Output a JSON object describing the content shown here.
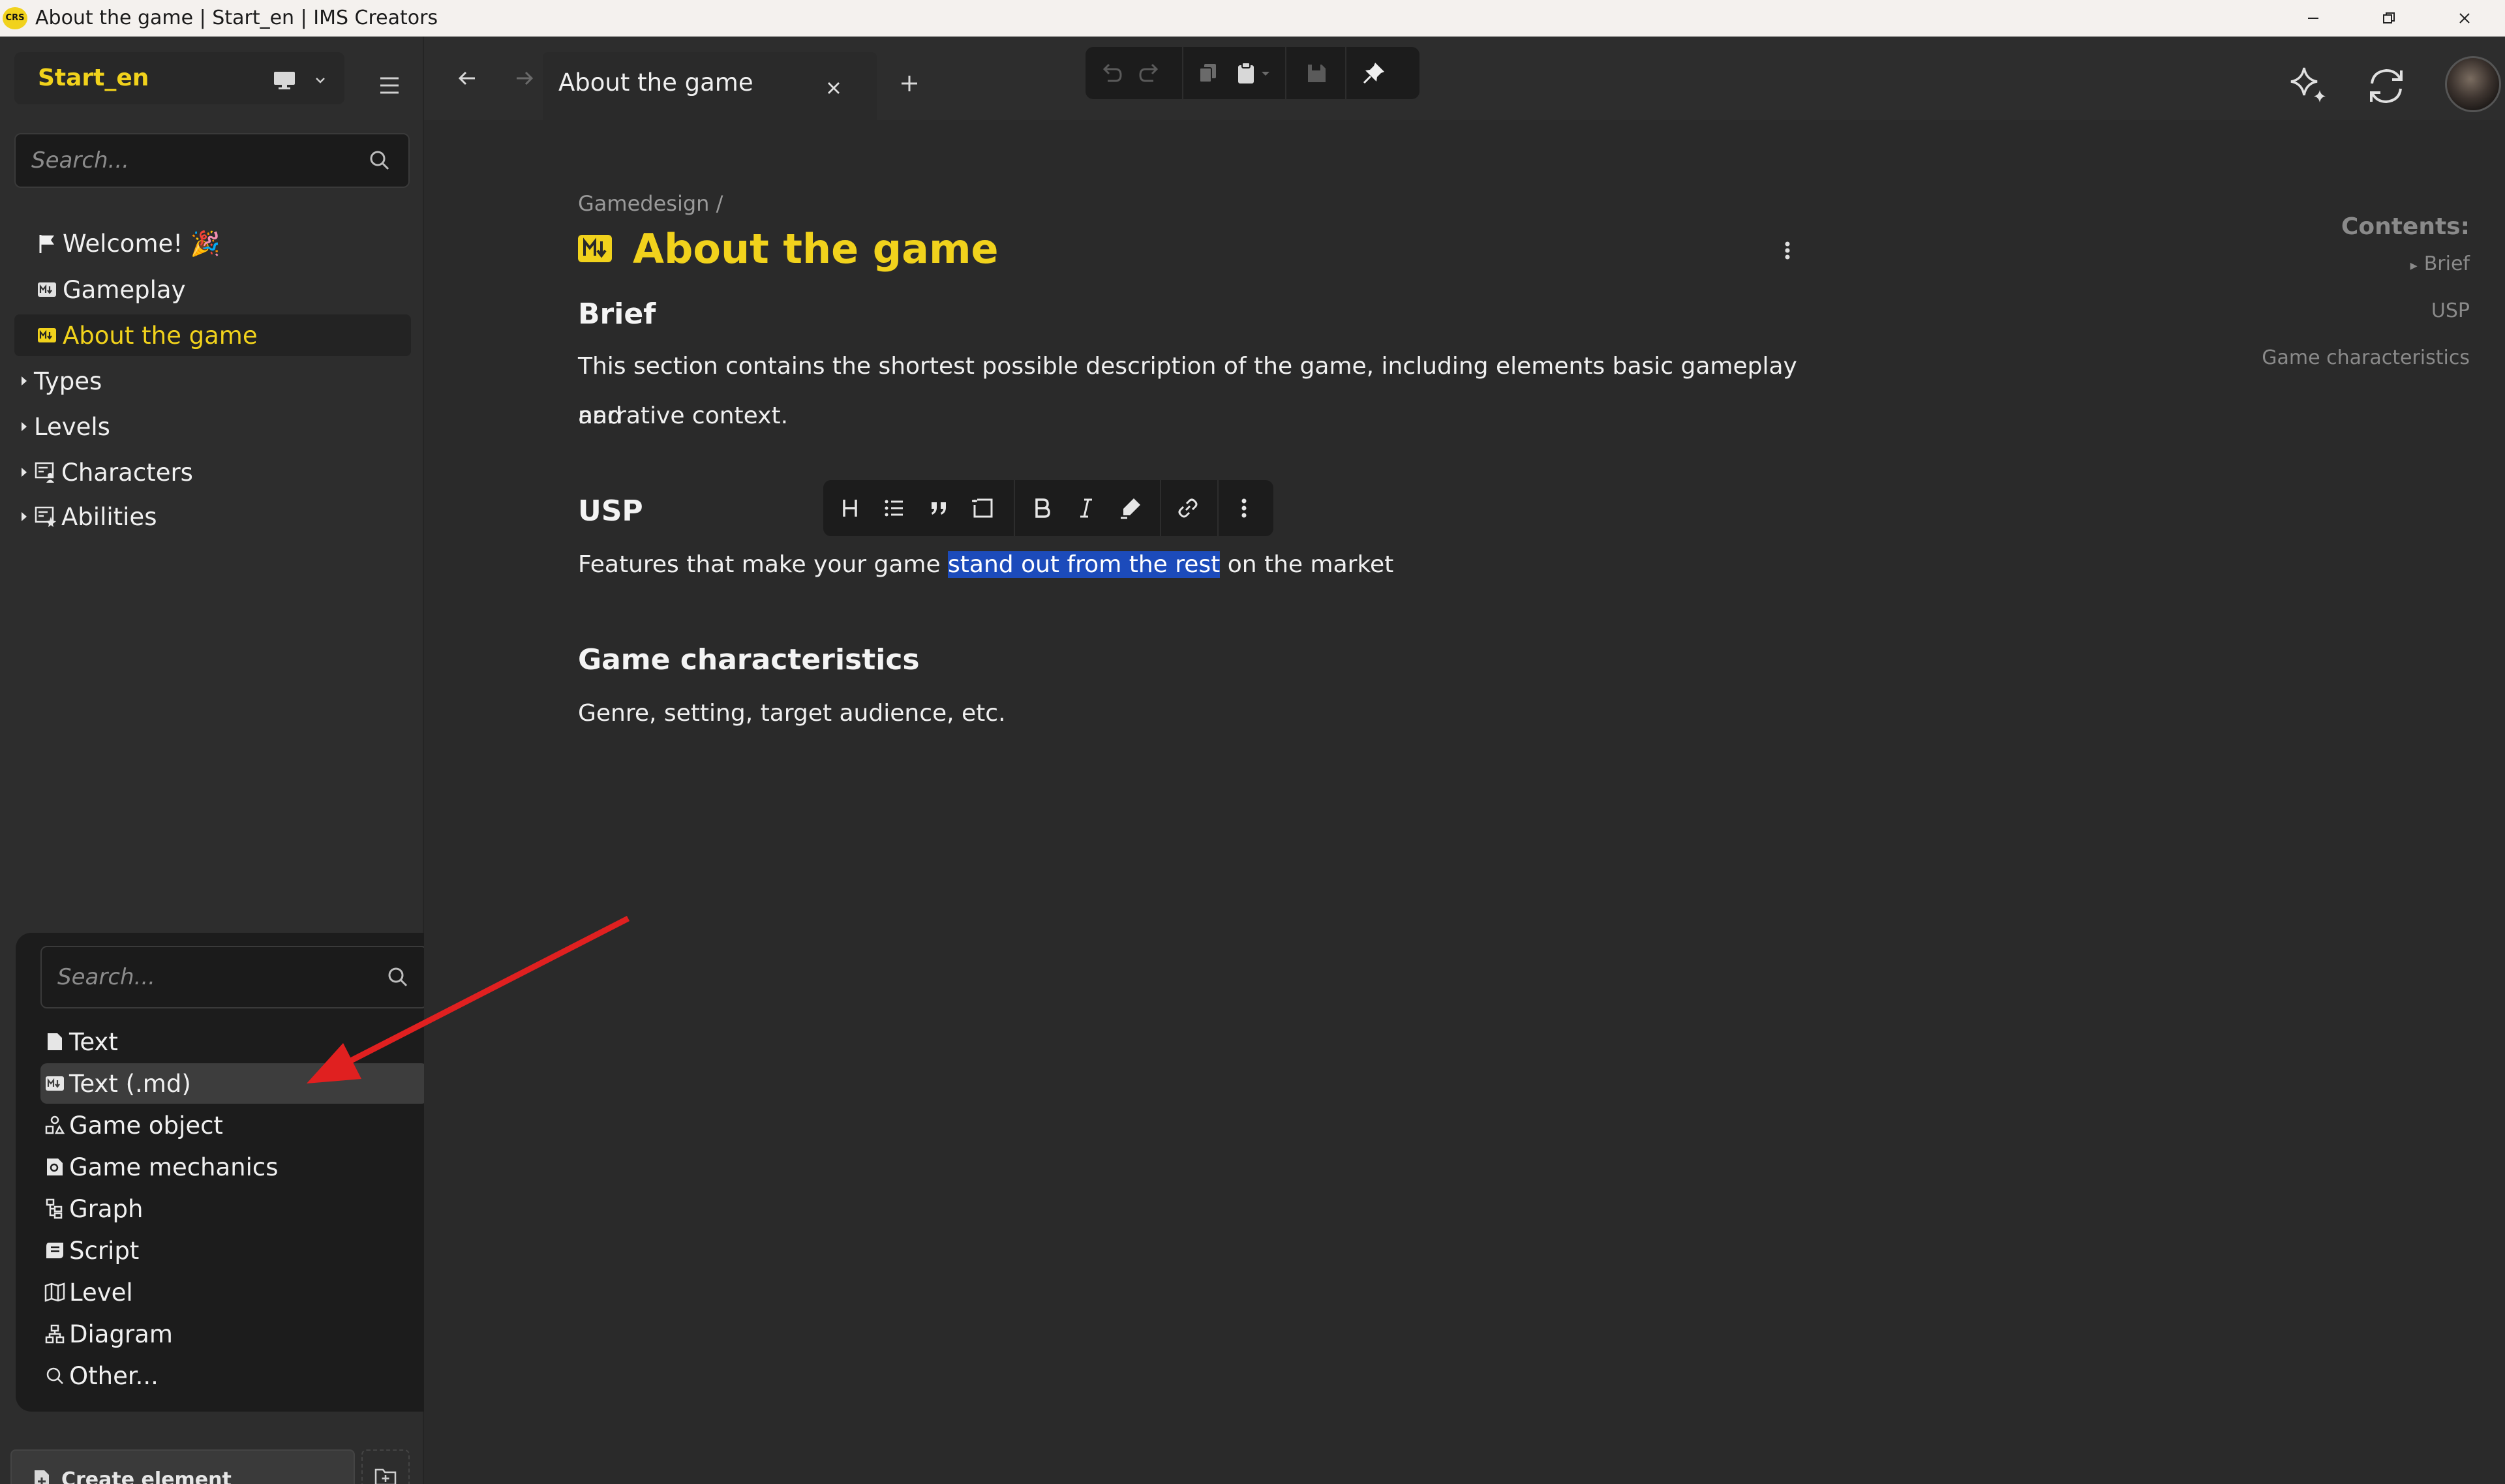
{
  "window": {
    "title": "About the game | Start_en | IMS Creators",
    "logo_text": "CRS"
  },
  "sidebar": {
    "project_name": "Start_en",
    "search_placeholder": "Search...",
    "tree": [
      {
        "label": "Welcome! 🎉",
        "icon": "flag-icon"
      },
      {
        "label": "Gameplay",
        "icon": "markdown-icon"
      },
      {
        "label": "About the game",
        "icon": "markdown-icon",
        "selected": true
      },
      {
        "label": "Types",
        "icon": "caret-right-icon"
      },
      {
        "label": "Levels",
        "icon": "caret-right-icon"
      },
      {
        "label": "Characters",
        "icon": "character-board-icon"
      },
      {
        "label": "Abilities",
        "icon": "ability-board-icon"
      }
    ],
    "create_button_label": "Create element"
  },
  "create_menu": {
    "search_placeholder": "Search...",
    "items": [
      {
        "label": "Text",
        "icon": "document-icon"
      },
      {
        "label": "Text (.md)",
        "icon": "markdown-icon",
        "highlighted": true
      },
      {
        "label": "Game object",
        "icon": "shapes-icon"
      },
      {
        "label": "Game mechanics",
        "icon": "gear-box-icon"
      },
      {
        "label": "Graph",
        "icon": "graph-icon"
      },
      {
        "label": "Script",
        "icon": "script-icon"
      },
      {
        "label": "Level",
        "icon": "map-icon"
      },
      {
        "label": "Diagram",
        "icon": "hierarchy-icon"
      },
      {
        "label": "Other...",
        "icon": "search-icon"
      }
    ]
  },
  "tabs": [
    {
      "label": "About the game",
      "active": true
    }
  ],
  "document": {
    "breadcrumb": "Gamedesign /",
    "title": "About the game",
    "sections": [
      {
        "heading": "Brief",
        "text_lines": [
          "This section contains the shortest possible description of the game, including elements basic gameplay and",
          "narrative context."
        ]
      },
      {
        "heading": "USP",
        "text_before": "Features that make your game ",
        "text_selected": "stand out from the rest",
        "text_after": " on the market"
      },
      {
        "heading": "Game characteristics",
        "text_lines": [
          "Genre, setting, target audience, etc."
        ]
      }
    ]
  },
  "toc": {
    "title": "Contents:",
    "items": [
      "Brief",
      "USP",
      "Game characteristics"
    ]
  },
  "colors": {
    "accent": "#f1d21c",
    "selection": "#1c4bbb",
    "annotation_arrow": "#e02020"
  }
}
